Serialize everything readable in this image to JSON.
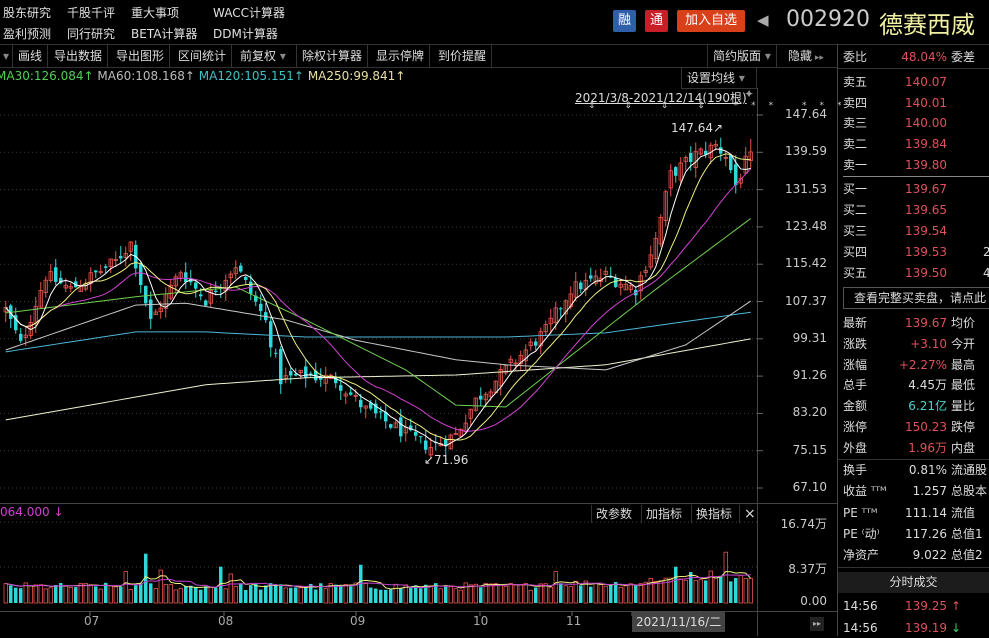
{
  "menu": {
    "row1": [
      "股东研究",
      "千股千评",
      "重大事项",
      "WACC计算器"
    ],
    "row2": [
      "盈利预测",
      "同行研究",
      "BETA计算器",
      "DDM计算器"
    ]
  },
  "header": {
    "tag_rong": "融",
    "tag_tong": "通",
    "add_watchlist": "加入自选",
    "code": "002920",
    "name": "德赛西威",
    "colors": {
      "rong": "#2f5fa8",
      "tong": "#c81e28",
      "add": "#d8401a",
      "name": "#f0f0a0"
    }
  },
  "toolbar": {
    "items": [
      "画线",
      "导出数据",
      "导出图形",
      "区间统计",
      "前复权",
      "除权计算器",
      "显示停牌",
      "到价提醒"
    ],
    "layout": "简约版面",
    "hide": "隐藏"
  },
  "ma_legend": {
    "ma30": "MA30:126.084",
    "ma60": "MA60:108.168",
    "ma120": "MA120:105.151",
    "ma250": "MA250:99.841",
    "arrow": "↑"
  },
  "main_chart": {
    "set_ma": "设置均线",
    "range_label": "2021/3/8-2021/12/14(190根)",
    "high_label": "147.64↗",
    "low_label": "↙71.96",
    "markers": "⇕ ⇕ ⇕ ⇕ *** ***"
  },
  "chart_data": {
    "type": "candlestick",
    "ylim": [
      67.1,
      147.64
    ],
    "y_ticks": [
      "147.64",
      "139.59",
      "131.53",
      "123.48",
      "115.42",
      "107.37",
      "99.31",
      "91.26",
      "83.20",
      "75.15",
      "67.10"
    ],
    "x_ticks": [
      "07",
      "08",
      "09",
      "10",
      "11"
    ],
    "bars": 150,
    "close_anchors": [
      [
        0,
        105.6
      ],
      [
        3,
        98
      ],
      [
        8,
        113
      ],
      [
        13,
        110
      ],
      [
        22,
        116
      ],
      [
        25,
        120
      ],
      [
        29,
        103
      ],
      [
        35,
        114
      ],
      [
        40,
        107.7
      ],
      [
        46,
        115.3
      ],
      [
        52,
        103
      ],
      [
        55,
        90.5
      ],
      [
        60,
        91.5
      ],
      [
        66,
        90.5
      ],
      [
        72,
        84
      ],
      [
        82,
        77.5
      ],
      [
        85,
        76
      ],
      [
        90,
        78.6
      ],
      [
        94,
        86
      ],
      [
        100,
        92.6
      ],
      [
        108,
        101
      ],
      [
        113,
        110
      ],
      [
        120,
        113
      ],
      [
        126,
        110
      ],
      [
        130,
        120.7
      ],
      [
        133,
        134.7
      ],
      [
        138,
        139
      ],
      [
        142,
        141
      ],
      [
        144,
        139
      ],
      [
        146,
        132.5
      ],
      [
        149,
        139.67
      ]
    ],
    "ma_series": {
      "MA30": [
        [
          0,
          104.9
        ],
        [
          26,
          108.4
        ],
        [
          46,
          110.5
        ],
        [
          60,
          103.4
        ],
        [
          80,
          92.6
        ],
        [
          90,
          85
        ],
        [
          100,
          84.6
        ],
        [
          112,
          94.8
        ],
        [
          130,
          110
        ],
        [
          150,
          126.1
        ]
      ],
      "MA60": [
        [
          0,
          96.9
        ],
        [
          26,
          106.6
        ],
        [
          36,
          107
        ],
        [
          56,
          103.4
        ],
        [
          70,
          99
        ],
        [
          90,
          94.8
        ],
        [
          100,
          93.7
        ],
        [
          120,
          92.6
        ],
        [
          136,
          98
        ],
        [
          150,
          108.2
        ]
      ],
      "MA120": [
        [
          0,
          96.5
        ],
        [
          26,
          100.8
        ],
        [
          40,
          100.8
        ],
        [
          60,
          99.7
        ],
        [
          100,
          99.7
        ],
        [
          120,
          100.6
        ],
        [
          150,
          105.2
        ]
      ],
      "MA250": [
        [
          0,
          81.8
        ],
        [
          40,
          89.4
        ],
        [
          60,
          90.9
        ],
        [
          90,
          91.5
        ],
        [
          120,
          93.7
        ],
        [
          150,
          99.5
        ]
      ]
    },
    "ma_colors": {
      "MA5": "#ffffff",
      "MA10": "#f0f080",
      "MA20": "#d040d0",
      "MA30": "#70d050",
      "MA60": "#c8c8c8",
      "MA120": "#4fb8d8",
      "MA250": "#f0f0d0"
    },
    "up_color": "#e8564f",
    "down_color": "#2fd8d8"
  },
  "volume_chart": {
    "legend": "064.000 ↓",
    "buttons": [
      "改参数",
      "加指标",
      "换指标"
    ],
    "close": "×",
    "y_ticks": [
      "16.74万",
      "8.37万",
      "0.00"
    ],
    "ylim": [
      0,
      16.74
    ],
    "spikes": [
      [
        28,
        10.2
      ],
      [
        24,
        6.5
      ],
      [
        31,
        6.8
      ],
      [
        43,
        7.5
      ],
      [
        45,
        6
      ],
      [
        71,
        7.9
      ],
      [
        110,
        6.5
      ],
      [
        134,
        7.5
      ],
      [
        137,
        6.4
      ],
      [
        141,
        6.6
      ],
      [
        144,
        10.5
      ],
      [
        139,
        4.8
      ]
    ],
    "cursor_date": "2021/11/16/二"
  },
  "order_book": {
    "ratio_label": "委比",
    "ratio": "48.04%",
    "diff_label": "委差",
    "asks": [
      {
        "l": "卖五",
        "p": "140.07"
      },
      {
        "l": "卖四",
        "p": "140.01"
      },
      {
        "l": "卖三",
        "p": "140.00"
      },
      {
        "l": "卖二",
        "p": "139.84"
      },
      {
        "l": "卖一",
        "p": "139.80"
      }
    ],
    "bids": [
      {
        "l": "买一",
        "p": "139.67",
        "v": ""
      },
      {
        "l": "买二",
        "p": "139.65",
        "v": ""
      },
      {
        "l": "买三",
        "p": "139.54",
        "v": ""
      },
      {
        "l": "买四",
        "p": "139.53",
        "v": "2"
      },
      {
        "l": "买五",
        "p": "139.50",
        "v": "4"
      }
    ],
    "full_book_button": "查看完整买卖盘，请点此"
  },
  "quote": [
    {
      "l": "最新",
      "v": "139.67",
      "c": "red",
      "l2": "均价"
    },
    {
      "l": "涨跌",
      "v": "+3.10",
      "c": "red",
      "l2": "今开"
    },
    {
      "l": "涨幅",
      "v": "+2.27%",
      "c": "red",
      "l2": "最高"
    },
    {
      "l": "总手",
      "v": "4.45万",
      "c": "white",
      "l2": "最低"
    },
    {
      "l": "金额",
      "v": "6.21亿",
      "c": "cyan",
      "l2": "量比"
    },
    {
      "l": "涨停",
      "v": "150.23",
      "c": "red",
      "l2": "跌停"
    },
    {
      "l": "外盘",
      "v": "1.96万",
      "c": "red",
      "l2": "内盘"
    }
  ],
  "fundamentals": [
    {
      "l": "换手",
      "v": "0.81%",
      "l2": "流通股"
    },
    {
      "l": "收益 ᵀᵀᴹ",
      "v": "1.257",
      "l2": "总股本"
    },
    {
      "l": "PE ᵀᵀᴹ",
      "v": "111.14",
      "l2": "流值"
    },
    {
      "l": "PE ⁽动⁾",
      "v": "117.26",
      "l2": "总值1"
    },
    {
      "l": "净资产",
      "v": "9.022",
      "l2": "总值2"
    }
  ],
  "ticks": {
    "title": "分时成交",
    "rows": [
      {
        "t": "14:56",
        "p": "139.25",
        "a": "↑",
        "ac": "#e0505a"
      },
      {
        "t": "14:56",
        "p": "139.19",
        "a": "↓",
        "ac": "#40d060"
      }
    ]
  }
}
